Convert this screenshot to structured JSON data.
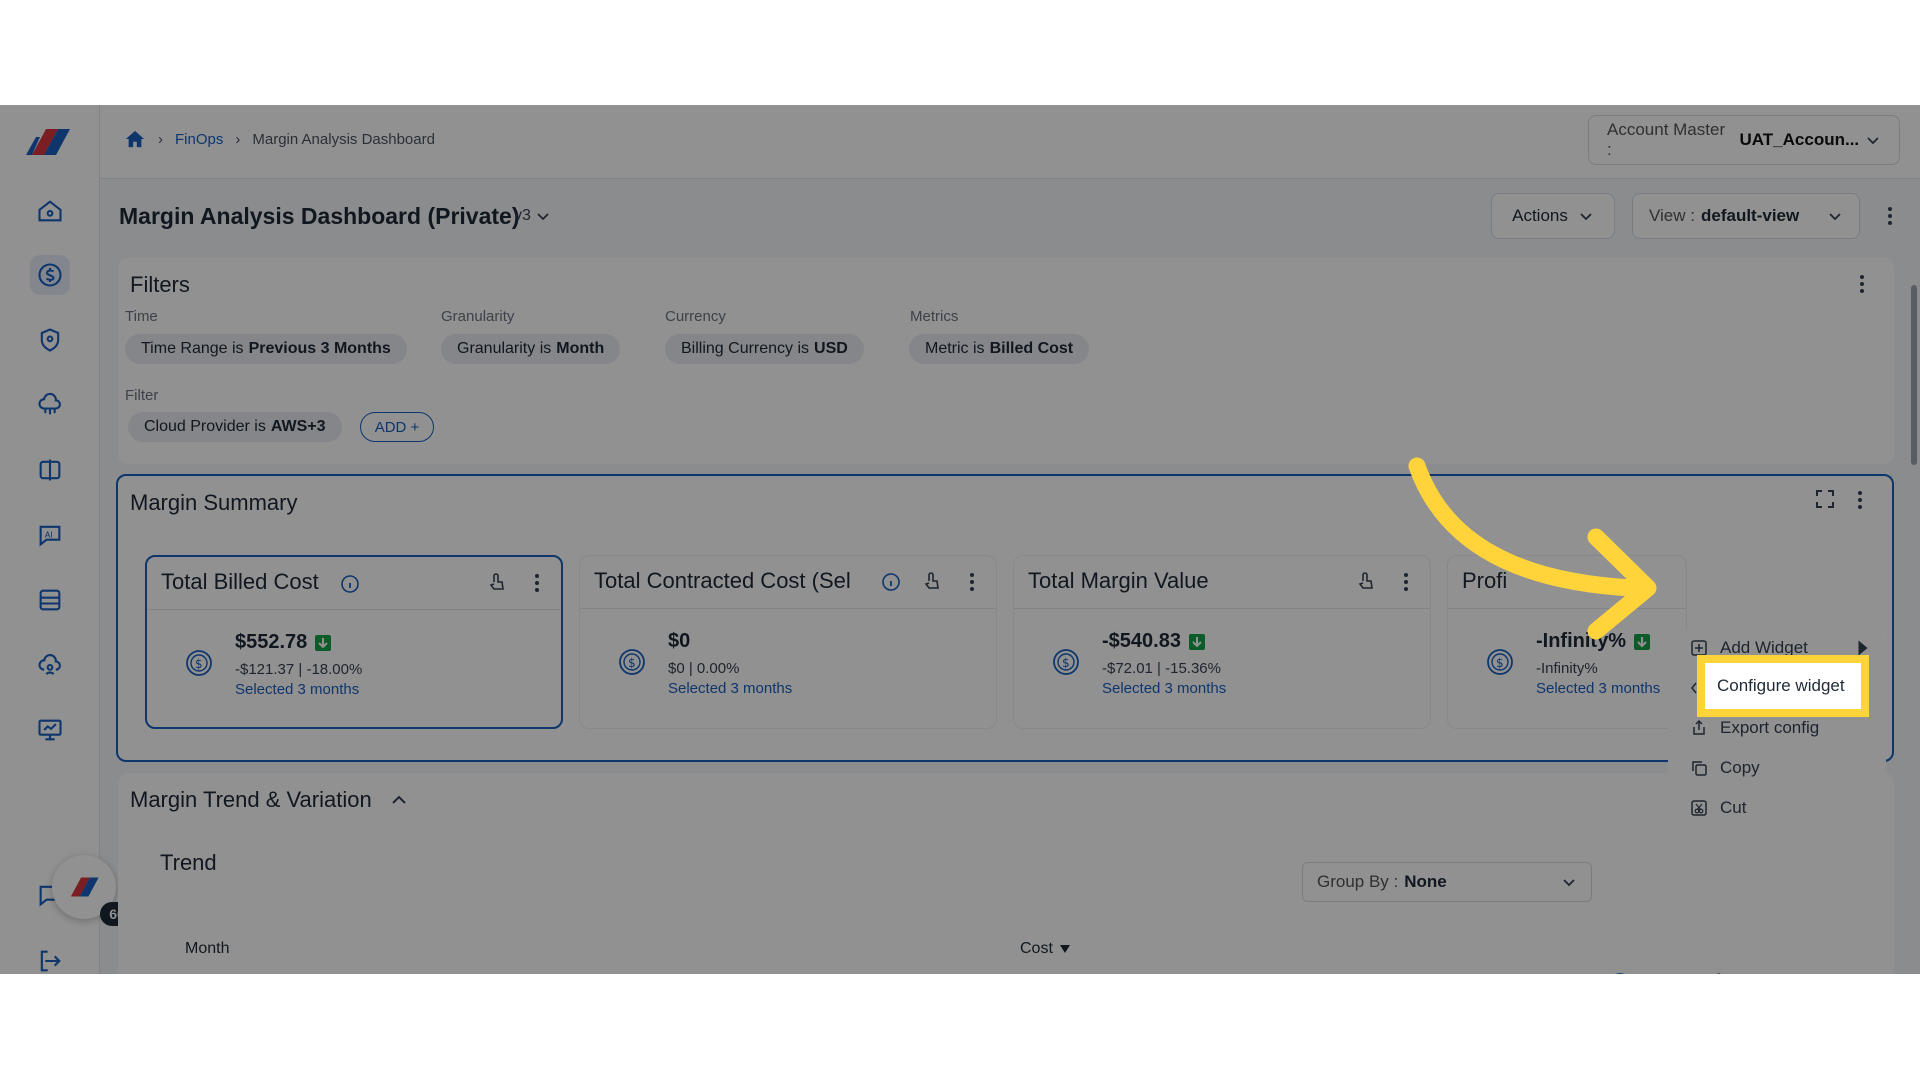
{
  "breadcrumb": {
    "home": "home",
    "section": "FinOps",
    "page": "Margin Analysis Dashboard"
  },
  "account": {
    "label": "Account Master :",
    "value": "UAT_Accoun..."
  },
  "header": {
    "title": "Margin Analysis Dashboard (Private)",
    "version": "v3",
    "actions_label": "Actions",
    "view_label": "View :",
    "view_value": "default-view"
  },
  "filters": {
    "title": "Filters",
    "groups": [
      {
        "label": "Time",
        "chip_prefix": "Time Range is",
        "chip_value": "Previous 3 Months"
      },
      {
        "label": "Granularity",
        "chip_prefix": "Granularity is",
        "chip_value": "Month"
      },
      {
        "label": "Currency",
        "chip_prefix": "Billing Currency is",
        "chip_value": "USD"
      },
      {
        "label": "Metrics",
        "chip_prefix": "Metric is",
        "chip_value": "Billed Cost"
      }
    ],
    "filter_label": "Filter",
    "filter_chip_prefix": "Cloud Provider is",
    "filter_chip_value": "AWS+3",
    "add_label": "ADD +"
  },
  "summary": {
    "title": "Margin Summary",
    "cards": [
      {
        "title": "Total Billed Cost",
        "value": "$552.78",
        "delta": "-$121.37 | -18.00%",
        "selected": "Selected 3 months"
      },
      {
        "title": "Total Contracted Cost (Sel",
        "value": "$0",
        "delta": "$0 | 0.00%",
        "selected": "Selected 3 months"
      },
      {
        "title": "Total Margin Value",
        "value": "-$540.83",
        "delta": "-$72.01 | -15.36%",
        "selected": "Selected 3 months"
      },
      {
        "title": "Profi",
        "value": "-Infinity%",
        "delta": "-Infinity%",
        "selected": "Selected 3 months"
      }
    ]
  },
  "trend": {
    "section_title": "Margin Trend & Variation",
    "widget_title": "Trend",
    "group_by_label": "Group By :",
    "group_by_value": "None",
    "columns": [
      "Month",
      "Cost"
    ]
  },
  "context_menu": {
    "items": [
      "Add Widget",
      "Configure widget",
      "Export config",
      "Copy",
      "Cut"
    ]
  },
  "notifications": {
    "count": "60"
  },
  "colors": {
    "accent": "#1a5fbf",
    "highlight": "#ffd43b",
    "positive": "#16a34a"
  }
}
